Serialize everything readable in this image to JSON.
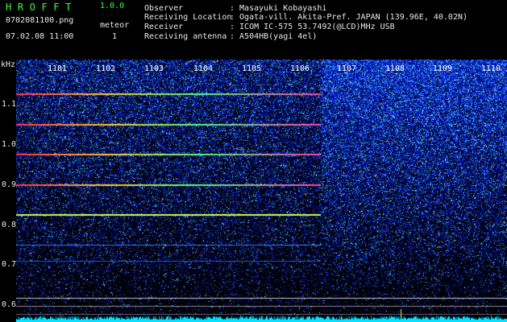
{
  "header": {
    "app_title": "HROFFT",
    "version": "1.0.0",
    "filename": "0702081100.png",
    "meteor_label": "meteor",
    "datetime": "07.02.08 11:00",
    "meteor_count": "1",
    "info": [
      {
        "label": "Observer",
        "value": ": Masayuki Kobayashi"
      },
      {
        "label": "Receiving Location",
        "value": ": Ogata-vill. Akita-Pref. JAPAN (139.96E, 40.02N)"
      },
      {
        "label": "Receiver",
        "value": ": ICOM IC-575 53.7492(@LCD)MHz USB"
      },
      {
        "label": "Receiving antenna",
        "value": ": A504HB(yagi 4el)"
      }
    ]
  },
  "spectrogram": {
    "y_axis_title": "kHz",
    "y_ticks": [
      "1.1",
      "1.0",
      "0.9",
      "0.8",
      "0.7",
      "0.6"
    ],
    "x_ticks": [
      "1101",
      "1102",
      "1103",
      "1104",
      "1105",
      "1106",
      "1107",
      "1108",
      "1109",
      "1110"
    ],
    "colors": {
      "background": "#000000",
      "text": "#e8e8e8",
      "accent": "#33ff33",
      "noise_floor": "#00ffff"
    }
  }
}
